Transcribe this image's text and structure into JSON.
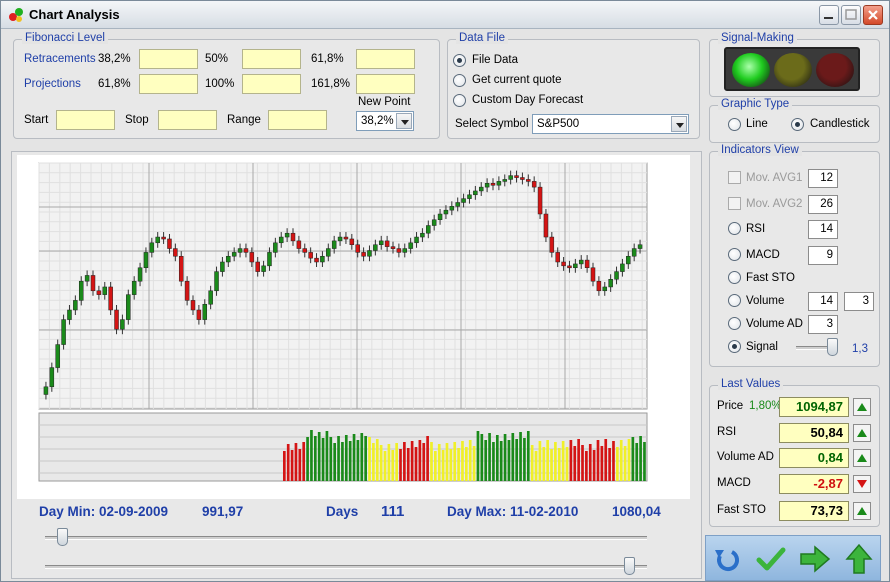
{
  "window": {
    "title": "Chart Analysis"
  },
  "fibonacci": {
    "title": "Fibonacci Level",
    "retracements_label": "Retracements",
    "retracements_pcts": [
      "38,2%",
      "50%",
      "61,8%"
    ],
    "projections_label": "Projections",
    "projections_pcts": [
      "61,8%",
      "100%",
      "161,8%"
    ],
    "start_label": "Start",
    "stop_label": "Stop",
    "range_label": "Range",
    "new_point_label": "New Point",
    "new_point_value": "38,2%"
  },
  "data_file": {
    "title": "Data File",
    "options": [
      "File Data",
      "Get current quote",
      "Custom Day Forecast"
    ],
    "selected_index": 0,
    "symbol_label": "Select Symbol",
    "symbol_value": "S&P500"
  },
  "signal": {
    "title": "Signal-Making",
    "colors": [
      "#1fcc1f",
      "#6b6b1a",
      "#6b1a1a"
    ]
  },
  "graphic_type": {
    "title": "Graphic Type",
    "options": [
      "Line",
      "Candlestick"
    ],
    "selected": "Candlestick"
  },
  "indicators": {
    "title": "Indicators View",
    "mov_avg1": {
      "label": "Mov. AVG1",
      "value": "12"
    },
    "mov_avg2": {
      "label": "Mov. AVG2",
      "value": "26"
    },
    "rsi": {
      "label": "RSI",
      "value": "14"
    },
    "macd": {
      "label": "MACD",
      "value": "9"
    },
    "fast_sto": {
      "label": "Fast STO"
    },
    "volume": {
      "label": "Volume",
      "value1": "14",
      "value2": "3"
    },
    "volume_ad": {
      "label": "Volume AD",
      "value": "3"
    },
    "signal": {
      "label": "Signal",
      "value": "1,3",
      "level": 1.0
    },
    "selected": "Signal"
  },
  "last_values": {
    "title": "Last Values",
    "rows": [
      {
        "label": "Price",
        "change": "1,80%",
        "value": "1094,87",
        "value_color": "#006400",
        "trend": "up"
      },
      {
        "label": "RSI",
        "value": "50,84",
        "value_color": "#000000",
        "trend": "up"
      },
      {
        "label": "Volume AD",
        "value": "0,84",
        "value_color": "#006400",
        "trend": "up"
      },
      {
        "label": "MACD",
        "value": "-2,87",
        "value_color": "#d01010",
        "trend": "down"
      },
      {
        "label": "Fast STO",
        "value": "73,73",
        "value_color": "#000000",
        "trend": "up"
      }
    ]
  },
  "stats": {
    "day_min": "Day Min: 02-09-2009",
    "min_value": "991,97",
    "days_label": "Days",
    "days_value": "111",
    "day_max": "Day Max: 11-02-2010",
    "max_value": "1080,04"
  },
  "sliders": {
    "top_position": 0.02,
    "bottom_position": 0.98
  },
  "chart_data": {
    "type": "candlestick",
    "count": 111,
    "close_trend": [
      1020,
      1030,
      1042,
      1055,
      1060,
      1065,
      1075,
      1078,
      1070,
      1068,
      1072,
      1060,
      1050,
      1055,
      1068,
      1075,
      1082,
      1090,
      1095,
      1098,
      1097,
      1092,
      1088,
      1075,
      1065,
      1060,
      1055,
      1063,
      1070,
      1080,
      1085,
      1088,
      1090,
      1092,
      1090,
      1085,
      1080,
      1083,
      1090,
      1095,
      1098,
      1100,
      1096,
      1092,
      1090,
      1087,
      1085,
      1088,
      1092,
      1096,
      1098,
      1097,
      1094,
      1090,
      1088,
      1091,
      1094,
      1096,
      1093,
      1092,
      1090,
      1092,
      1095,
      1098,
      1100,
      1104,
      1107,
      1110,
      1112,
      1114,
      1116,
      1118,
      1120,
      1122,
      1124,
      1126,
      1125,
      1127,
      1128,
      1130,
      1129,
      1128,
      1127,
      1124,
      1110,
      1098,
      1090,
      1085,
      1083,
      1082,
      1084,
      1086,
      1082,
      1075,
      1070,
      1072,
      1076,
      1080,
      1084,
      1088,
      1092,
      1094
    ]
  },
  "volume_data": {
    "colors": [
      "#d41414",
      "#1a8a1a",
      "#f0f028"
    ]
  }
}
